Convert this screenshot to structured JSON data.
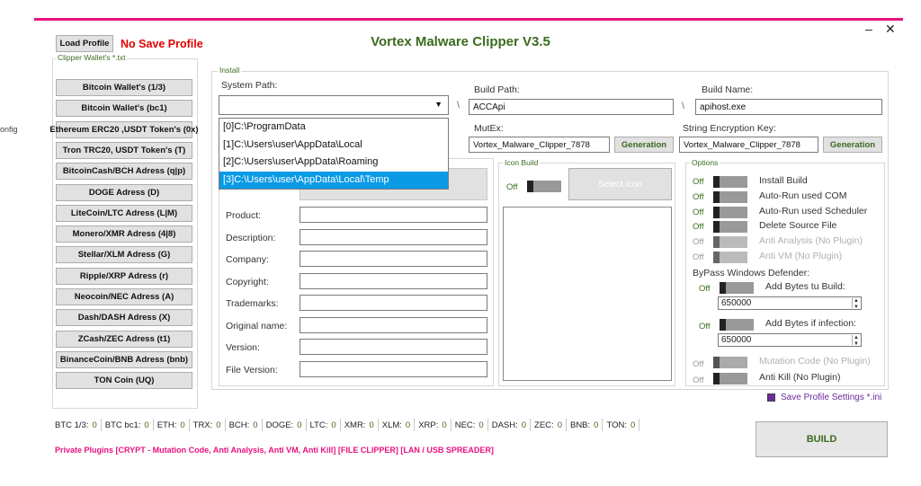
{
  "window": {
    "title": "Vortex Malware Clipper V3.5",
    "min": "–",
    "close": "✕"
  },
  "header": {
    "load_profile": "Load Profile",
    "no_save": "No Save Profile"
  },
  "side_text": "onfig",
  "wallets": {
    "group_label": "Clipper Wallet's *.txt",
    "items": [
      "Bitcoin Wallet's (1/3)",
      "Bitcoin Wallet's (bc1)",
      "Ethereum ERC20 ,USDT Token's (0x)",
      "Tron TRC20, USDT Token's (T)",
      "BitcoinCash/BCH Adress (q|p)",
      "DOGE Adress (D)",
      "LiteCoin/LTC Adress (L|M)",
      "Monero/XMR Adress (4|8)",
      "Stellar/XLM Adress (G)",
      "Ripple/XRP Adress (r)",
      "Neocoin/NEC Adress (A)",
      "Dash/DASH Adress (X)",
      "ZCash/ZEC Adress (t1)",
      "BinanceCoin/BNB Adress (bnb)",
      "TON Coin (UQ)"
    ]
  },
  "install": {
    "group_label": "Install",
    "system_path_label": "System Path:",
    "build_path_label": "Build Path:",
    "build_path": "ACCApi",
    "build_name_label": "Build Name:",
    "build_name": "apihost.exe",
    "backslash": "\\",
    "dropdown": [
      "[0]C:\\ProgramData",
      "[1]C:\\Users\\user\\AppData\\Local",
      "[2]C:\\Users\\user\\AppData\\Roaming",
      "[3]C:\\Users\\user\\AppData\\Local\\Temp"
    ],
    "mutex_label": "MutEx:",
    "mutex": "Vortex_Malware_Clipper_7878",
    "key_label": "String Encryption Key:",
    "key": "Vortex_Malware_Clipper_7878",
    "generation": "Generation",
    "assembly_fields": [
      "Product:",
      "Description:",
      "Company:",
      "Copyright:",
      "Trademarks:",
      "Original name:",
      "Version:",
      "File Version:"
    ]
  },
  "icon_build": {
    "label": "Icon Build",
    "off": "Off",
    "select": "Select icon"
  },
  "options": {
    "label": "Options",
    "off": "Off",
    "items": [
      {
        "text": "Install Build",
        "dim": false
      },
      {
        "text": "Auto-Run used COM",
        "dim": false
      },
      {
        "text": "Auto-Run used Scheduler",
        "dim": false
      },
      {
        "text": "Delete Source File",
        "dim": false
      },
      {
        "text": "Anti Analysis (No Plugin)",
        "dim": true
      },
      {
        "text": "Anti VM (No Plugin)",
        "dim": true
      }
    ],
    "bypass_label": "ByPass Windows Defender:",
    "add_bytes_build": "Add Bytes tu Build:",
    "add_bytes_build_value": "650000",
    "add_bytes_infection": "Add Bytes if infection:",
    "add_bytes_infection_value": "650000",
    "mutation": "Mutation Code (No Plugin)",
    "anti_kill": "Anti Kill (No Plugin)",
    "save_settings": "Save Profile Settings *.ini"
  },
  "status": [
    {
      "k": "BTC 1/3:",
      "v": "0"
    },
    {
      "k": "BTC bc1:",
      "v": "0"
    },
    {
      "k": "ETH:",
      "v": "0"
    },
    {
      "k": "TRX:",
      "v": "0"
    },
    {
      "k": "BCH:",
      "v": "0"
    },
    {
      "k": "DOGE:",
      "v": "0"
    },
    {
      "k": "LTC:",
      "v": "0"
    },
    {
      "k": "XMR:",
      "v": "0"
    },
    {
      "k": "XLM:",
      "v": "0"
    },
    {
      "k": "XRP:",
      "v": "0"
    },
    {
      "k": "NEC:",
      "v": "0"
    },
    {
      "k": "DASH:",
      "v": "0"
    },
    {
      "k": "ZEC:",
      "v": "0"
    },
    {
      "k": "BNB:",
      "v": "0"
    },
    {
      "k": "TON:",
      "v": "0"
    }
  ],
  "footer": "Private Plugins [CRYPT - Mutation Code, Anti Analysis, Anti VM, Anti Kill] [FILE CLIPPER] [LAN / USB SPREADER]",
  "build_button": "BUILD",
  "colors": {
    "accent_pink": "#e8117f",
    "title_green": "#3b6b1e",
    "red": "#e00000",
    "selection_blue": "#0a9ae6"
  }
}
